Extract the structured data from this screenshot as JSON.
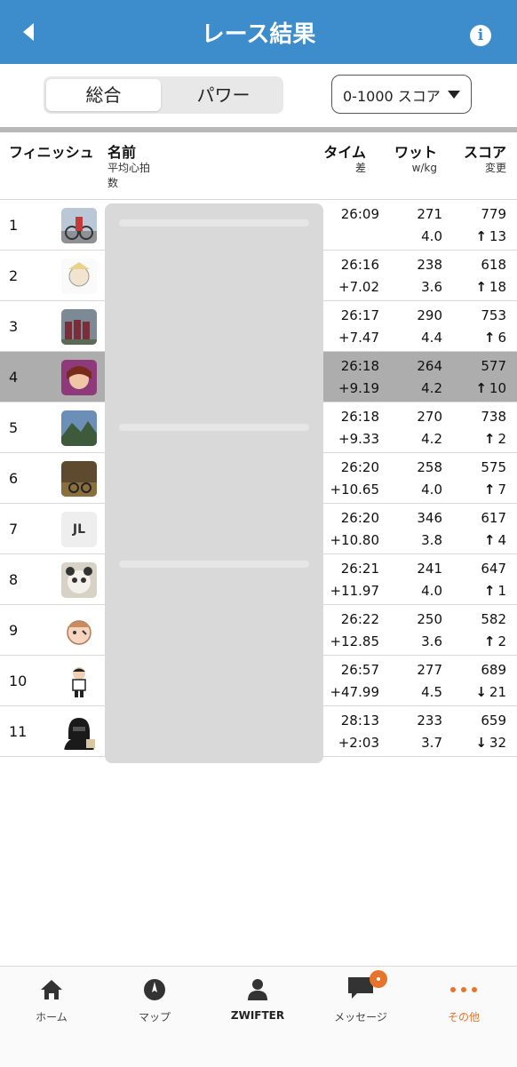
{
  "header": {
    "title": "レース結果",
    "info_icon": "i"
  },
  "segment": {
    "option1": "総合",
    "option2": "パワー"
  },
  "dropdown": {
    "value": "0-1000 スコア"
  },
  "columns": {
    "finish": "フィニッシュ",
    "name": "名前",
    "name_sub1": "平均心拍",
    "name_sub2": "数",
    "time": "タイム",
    "time_sub": "差",
    "watt": "ワット",
    "watt_sub": "w/kg",
    "score": "スコア",
    "score_sub": "変更"
  },
  "rows": [
    {
      "rank": "1",
      "time": "26:09",
      "gap": "",
      "watt": "271",
      "wkg": "4.0",
      "score": "779",
      "arrow": "↑",
      "change": "13"
    },
    {
      "rank": "2",
      "time": "26:16",
      "gap": "+7.02",
      "watt": "238",
      "wkg": "3.6",
      "score": "618",
      "arrow": "↑",
      "change": "18"
    },
    {
      "rank": "3",
      "time": "26:17",
      "gap": "+7.47",
      "watt": "290",
      "wkg": "4.4",
      "score": "753",
      "arrow": "↑",
      "change": "6"
    },
    {
      "rank": "4",
      "time": "26:18",
      "gap": "+9.19",
      "watt": "264",
      "wkg": "4.2",
      "score": "577",
      "arrow": "↑",
      "change": "10"
    },
    {
      "rank": "5",
      "time": "26:18",
      "gap": "+9.33",
      "watt": "270",
      "wkg": "4.2",
      "score": "738",
      "arrow": "↑",
      "change": "2"
    },
    {
      "rank": "6",
      "time": "26:20",
      "gap": "+10.65",
      "watt": "258",
      "wkg": "4.0",
      "score": "575",
      "arrow": "↑",
      "change": "7"
    },
    {
      "rank": "7",
      "time": "26:20",
      "gap": "+10.80",
      "watt": "346",
      "wkg": "3.8",
      "score": "617",
      "arrow": "↑",
      "change": "4"
    },
    {
      "rank": "8",
      "time": "26:21",
      "gap": "+11.97",
      "watt": "241",
      "wkg": "4.0",
      "score": "647",
      "arrow": "↑",
      "change": "1"
    },
    {
      "rank": "9",
      "time": "26:22",
      "gap": "+12.85",
      "watt": "250",
      "wkg": "3.6",
      "score": "582",
      "arrow": "↑",
      "change": "2"
    },
    {
      "rank": "10",
      "time": "26:57",
      "gap": "+47.99",
      "watt": "277",
      "wkg": "4.5",
      "score": "689",
      "arrow": "↓",
      "change": "21"
    },
    {
      "rank": "11",
      "time": "28:13",
      "gap": "+2:03",
      "watt": "233",
      "wkg": "3.7",
      "score": "659",
      "arrow": "↓",
      "change": "32"
    }
  ],
  "avatar7_text": "JL",
  "tabs": {
    "home": "ホーム",
    "map": "マップ",
    "zwifter": "ZWIFTER",
    "messages": "メッセージ",
    "more": "その他"
  },
  "colors": {
    "header": "#3d8ccb",
    "accent": "#e8742b",
    "highlight_row": "#adadad"
  }
}
